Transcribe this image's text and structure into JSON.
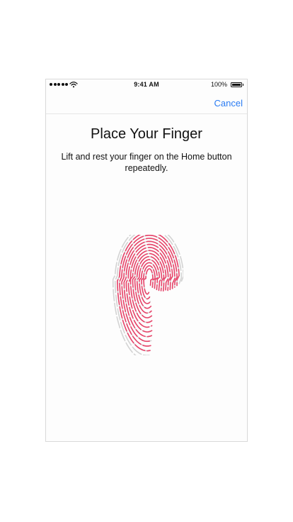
{
  "status_bar": {
    "time": "9:41 AM",
    "battery_text": "100%",
    "signal_icon": "signal-dots-icon",
    "wifi_icon": "wifi-icon",
    "battery_icon": "battery-icon"
  },
  "nav": {
    "cancel_label": "Cancel"
  },
  "main": {
    "title": "Place Your Finger",
    "subtitle": "Lift and rest your finger on the Home button repeatedly."
  },
  "fingerprint": {
    "icon": "fingerprint-icon",
    "active_color": "#e8446a",
    "inactive_color": "#d3d3d3"
  },
  "colors": {
    "accent": "#2a7cf3",
    "text": "#111111"
  }
}
